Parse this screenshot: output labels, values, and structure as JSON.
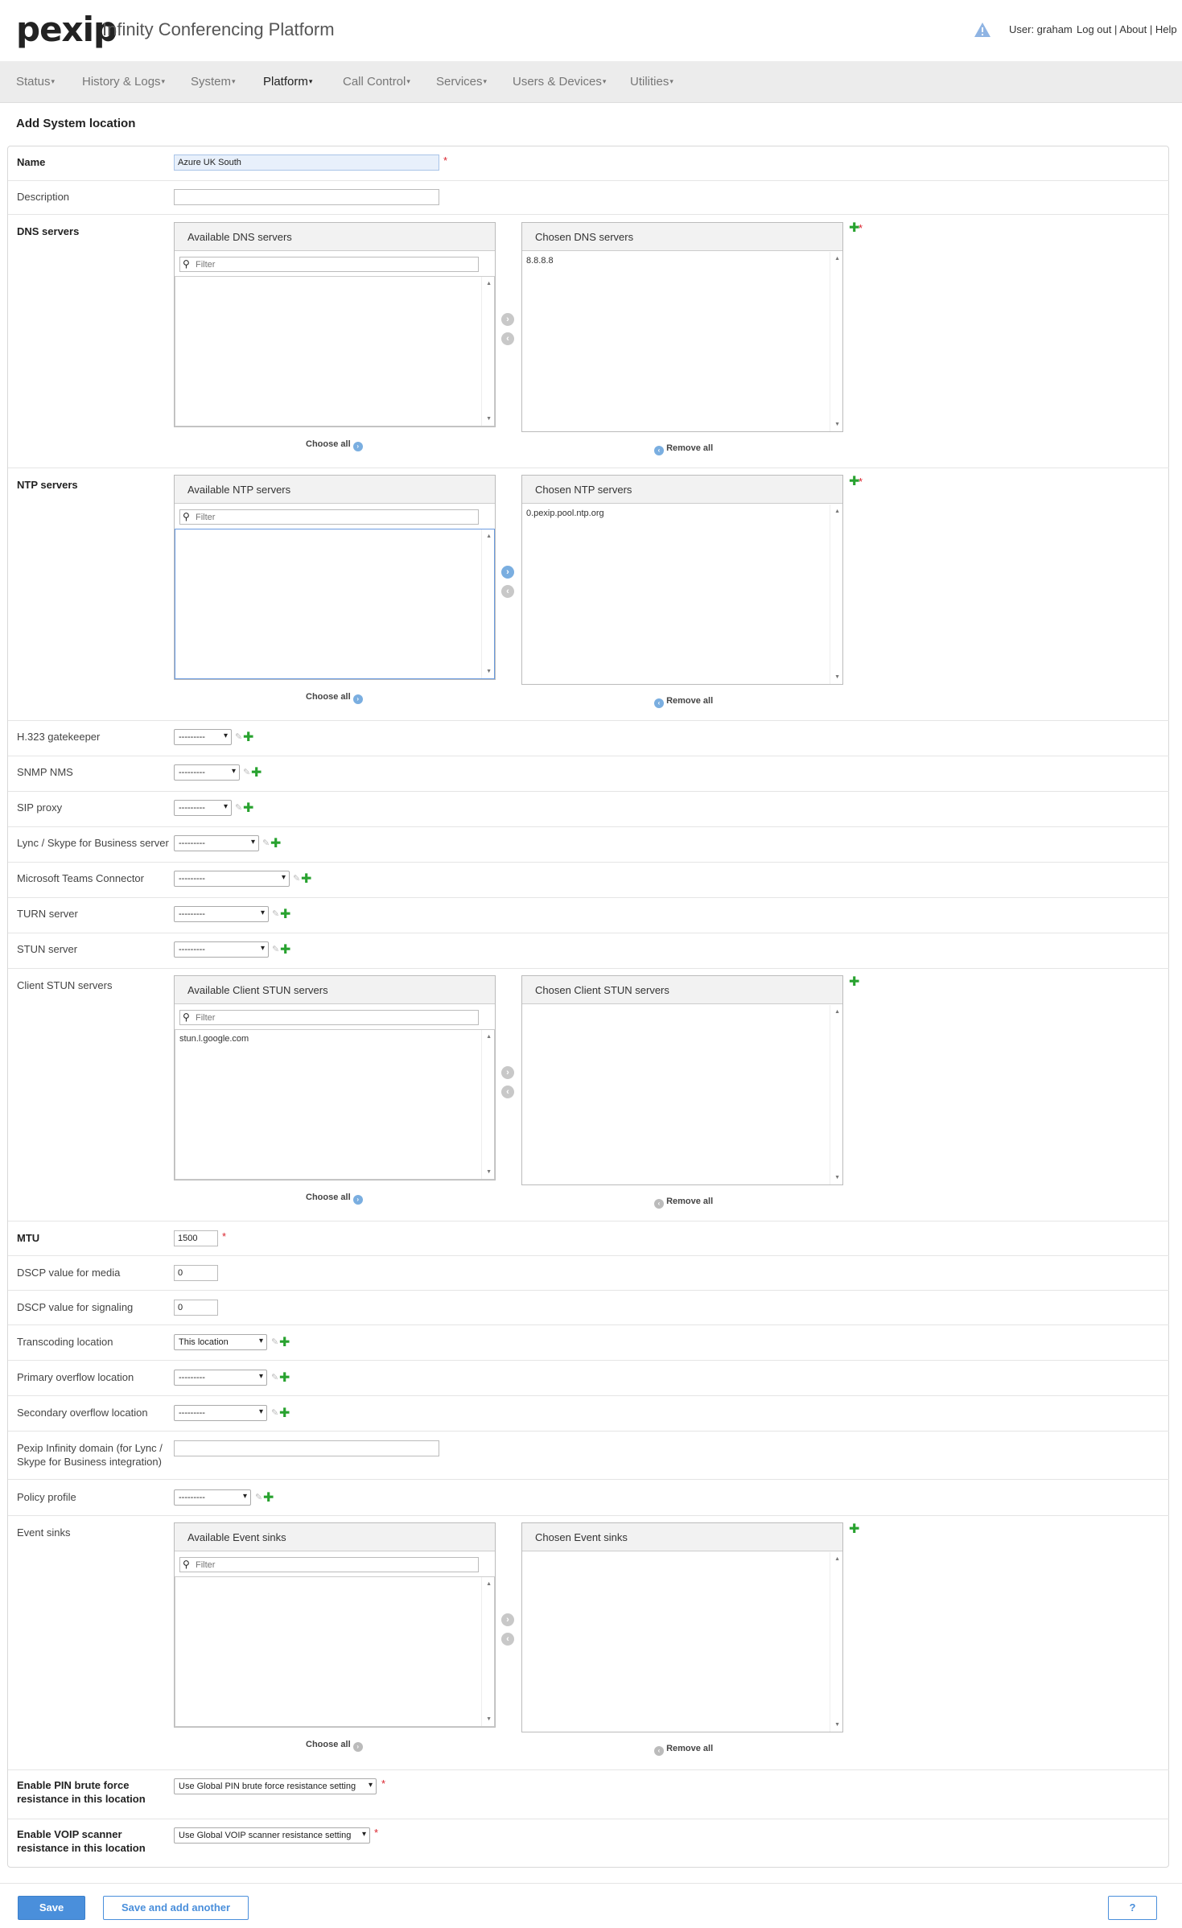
{
  "header": {
    "logo": "pexip",
    "app_title": "Infinity Conferencing Platform",
    "user": "User: graham",
    "logout": "Log out",
    "about": "About",
    "help": "Help"
  },
  "nav": [
    "Status",
    "History & Logs",
    "System",
    "Platform",
    "Call Control",
    "Services",
    "Users & Devices",
    "Utilities"
  ],
  "page_title": "Add System location",
  "form": {
    "name_label": "Name",
    "name_value": "Azure UK South",
    "description_label": "Description",
    "description_value": "",
    "dns_label": "DNS servers",
    "dns_available_title": "Available DNS servers",
    "dns_chosen_title": "Chosen DNS servers",
    "dns_chosen_items": [
      "8.8.8.8"
    ],
    "ntp_label": "NTP servers",
    "ntp_available_title": "Available NTP servers",
    "ntp_chosen_title": "Chosen NTP servers",
    "ntp_chosen_items": [
      "0.pexip.pool.ntp.org"
    ],
    "h323_label": "H.323 gatekeeper",
    "snmp_label": "SNMP NMS",
    "sip_label": "SIP proxy",
    "lync_label": "Lync / Skype for Business server",
    "teams_label": "Microsoft Teams Connector",
    "turn_label": "TURN server",
    "stun_label": "STUN server",
    "client_stun_label": "Client STUN servers",
    "client_stun_available_title": "Available Client STUN servers",
    "client_stun_chosen_title": "Chosen Client STUN servers",
    "client_stun_available_items": [
      "stun.l.google.com"
    ],
    "mtu_label": "MTU",
    "mtu_value": "1500",
    "dscp_media_label": "DSCP value for media",
    "dscp_media_value": "0",
    "dscp_signaling_label": "DSCP value for signaling",
    "dscp_signaling_value": "0",
    "transcoding_label": "Transcoding location",
    "transcoding_value": "This location",
    "primary_overflow_label": "Primary overflow location",
    "secondary_overflow_label": "Secondary overflow location",
    "pexip_domain_label_1": "Pexip Infinity domain (for Lync /",
    "pexip_domain_label_2": "Skype for Business integration)",
    "policy_label": "Policy profile",
    "event_sinks_label": "Event sinks",
    "event_available_title": "Available Event sinks",
    "event_chosen_title": "Chosen Event sinks",
    "pin_label_1": "Enable PIN brute force",
    "pin_label_2": "resistance in this location",
    "pin_value": "Use Global PIN brute force resistance setting",
    "voip_label_1": "Enable VOIP scanner",
    "voip_label_2": "resistance in this location",
    "voip_value": "Use Global VOIP scanner resistance setting",
    "empty_select": "---------",
    "filter_placeholder": "Filter",
    "choose_all": "Choose all",
    "remove_all": "Remove all",
    "required_mark": "*"
  },
  "footer": {
    "save": "Save",
    "save_add": "Save and add another",
    "help": "?"
  }
}
